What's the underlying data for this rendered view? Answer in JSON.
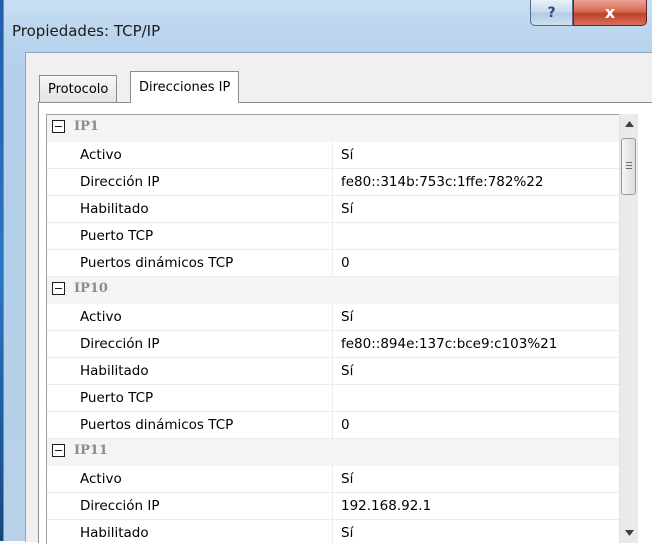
{
  "window": {
    "title": "Propiedades: TCP/IP",
    "help_label": "?",
    "close_label": "x"
  },
  "tabs": [
    {
      "label": "Protocolo",
      "selected": false
    },
    {
      "label": "Direcciones IP",
      "selected": true
    }
  ],
  "colors": {
    "close_button": "#c2412a",
    "category_text": "#8c8c8c",
    "category_background": "#f4f4f4"
  },
  "groups": [
    {
      "name": "IP1",
      "properties": [
        {
          "name": "Activo",
          "value": "Sí"
        },
        {
          "name": "Dirección IP",
          "value": "fe80::314b:753c:1ffe:782%22"
        },
        {
          "name": "Habilitado",
          "value": "Sí"
        },
        {
          "name": "Puerto TCP",
          "value": ""
        },
        {
          "name": "Puertos dinámicos TCP",
          "value": "0"
        }
      ]
    },
    {
      "name": "IP10",
      "properties": [
        {
          "name": "Activo",
          "value": "Sí"
        },
        {
          "name": "Dirección IP",
          "value": "fe80::894e:137c:bce9:c103%21"
        },
        {
          "name": "Habilitado",
          "value": "Sí"
        },
        {
          "name": "Puerto TCP",
          "value": ""
        },
        {
          "name": "Puertos dinámicos TCP",
          "value": "0"
        }
      ]
    },
    {
      "name": "IP11",
      "properties": [
        {
          "name": "Activo",
          "value": "Sí"
        },
        {
          "name": "Dirección IP",
          "value": "192.168.92.1"
        },
        {
          "name": "Habilitado",
          "value": "Sí"
        }
      ]
    }
  ],
  "icons": {
    "collapse": "minus-box-icon",
    "scroll_up": "arrow-up-icon",
    "scroll_down": "arrow-down-icon",
    "help": "question-icon",
    "close": "close-icon"
  }
}
